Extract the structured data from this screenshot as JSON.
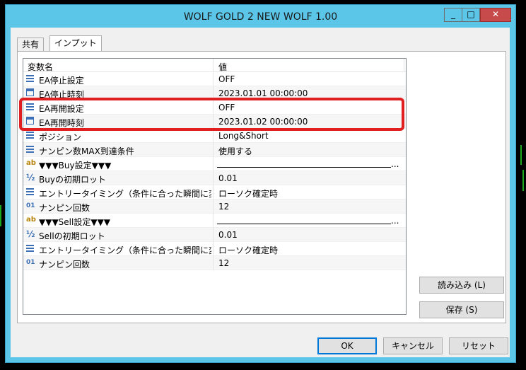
{
  "window": {
    "title": "WOLF GOLD 2 NEW WOLF 1.00",
    "buttons": {
      "minimize": "_",
      "maximize": "□",
      "close": "✕"
    }
  },
  "tabs": [
    {
      "label": "共有",
      "active": false
    },
    {
      "label": "インプット",
      "active": true
    }
  ],
  "grid": {
    "columns": [
      "変数名",
      "値"
    ],
    "rows": [
      {
        "icon": "list-icon",
        "name": "EA停止設定",
        "value": "OFF"
      },
      {
        "icon": "calendar-icon",
        "name": "EA停止時刻",
        "value": "2023.01.01 00:00:00"
      },
      {
        "icon": "list-icon",
        "name": "EA再開設定",
        "value": "OFF"
      },
      {
        "icon": "calendar-icon",
        "name": "EA再開時刻",
        "value": "2023.01.02 00:00:00"
      },
      {
        "icon": "list-icon",
        "name": "ポジション",
        "value": "Long&Short"
      },
      {
        "icon": "list-icon",
        "name": "ナンピン数MAX到達条件",
        "value": "使用する"
      },
      {
        "icon": "text-icon",
        "name": "▼▼▼Buy設定▼▼▼",
        "value": "..."
      },
      {
        "icon": "fraction-icon",
        "name": "Buyの初期ロット",
        "value": "0.01"
      },
      {
        "icon": "list-icon",
        "name": "エントリータイミング（条件に合った瞬間に変更す...",
        "value": "ローソク確定時"
      },
      {
        "icon": "integer-icon",
        "name": "ナンピン回数",
        "value": "12"
      },
      {
        "icon": "text-icon",
        "name": "▼▼▼Sell設定▼▼▼",
        "value": "..."
      },
      {
        "icon": "fraction-icon",
        "name": "Sellの初期ロット",
        "value": "0.01"
      },
      {
        "icon": "list-icon",
        "name": "エントリータイミング（条件に合った瞬間に変更す...",
        "value": "ローソク確定時"
      },
      {
        "icon": "integer-icon",
        "name": "ナンピン回数",
        "value": "12"
      }
    ],
    "icon_glyphs": {
      "text-icon": "ab",
      "fraction-icon": "½",
      "integer-icon": "01"
    }
  },
  "side_buttons": {
    "load": "読み込み (L)",
    "save": "保存 (S)"
  },
  "footer_buttons": {
    "ok": "OK",
    "cancel": "キャンセル",
    "reset": "リセット"
  },
  "colors": {
    "titlebar": "#5bc6e8",
    "highlight": "#e02020",
    "close": "#c74b4b"
  }
}
